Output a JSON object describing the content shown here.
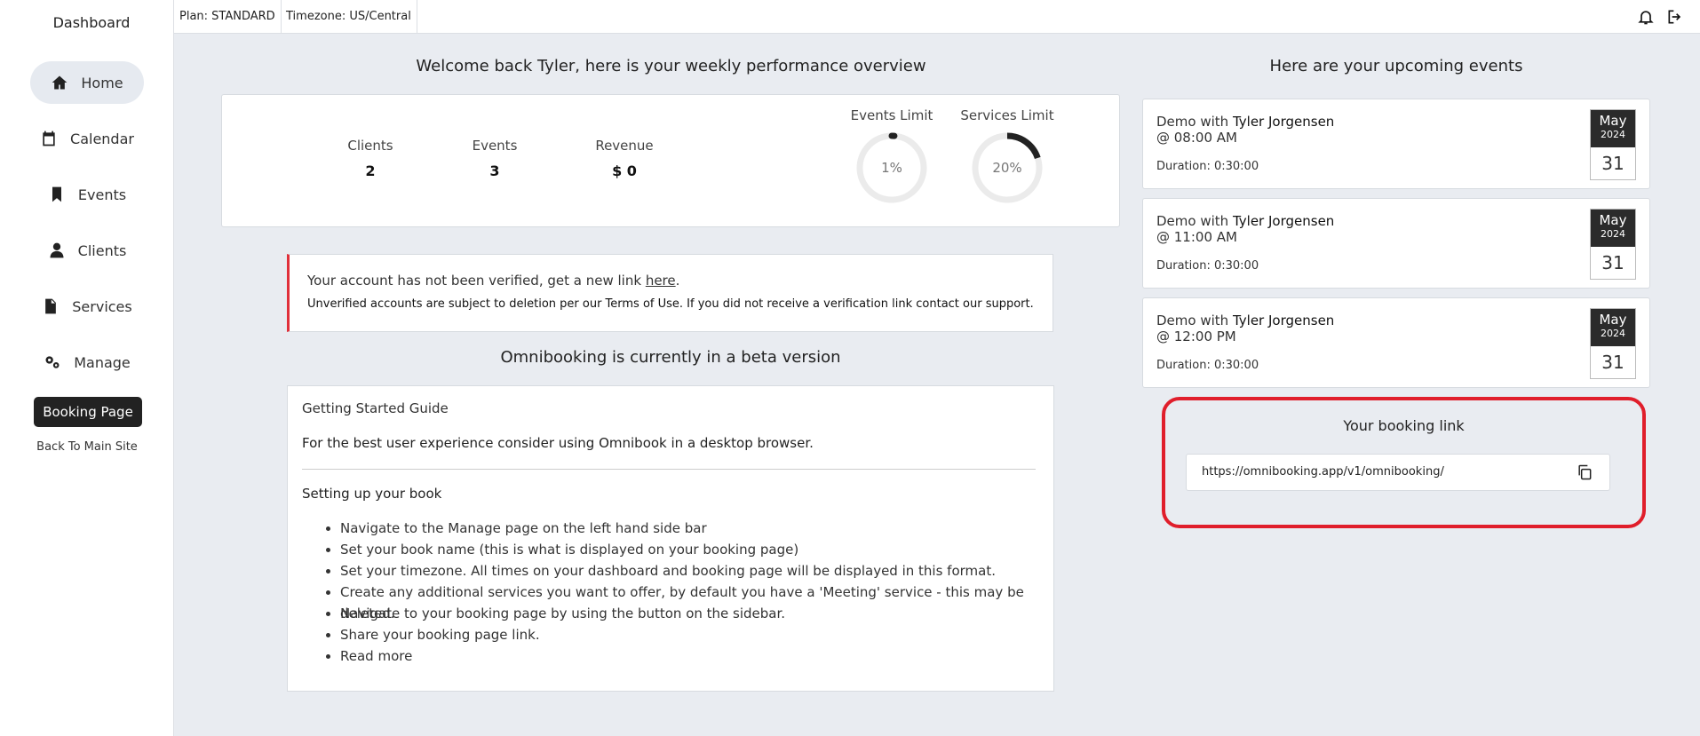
{
  "sidebar": {
    "title": "Dashboard",
    "items": [
      {
        "label": "Home",
        "icon": "home-icon",
        "active": true
      },
      {
        "label": "Calendar",
        "icon": "calendar-icon"
      },
      {
        "label": "Events",
        "icon": "bookmark-icon"
      },
      {
        "label": "Clients",
        "icon": "user-icon"
      },
      {
        "label": "Services",
        "icon": "document-icon"
      },
      {
        "label": "Manage",
        "icon": "gears-icon"
      }
    ],
    "booking_button": "Booking Page",
    "back_link": "Back To Main Site"
  },
  "topbar": {
    "plan": "Plan: STANDARD",
    "timezone": "Timezone: US/Central",
    "icons": [
      "bell-icon",
      "logout-icon"
    ]
  },
  "overview": {
    "heading": "Welcome back Tyler, here is your weekly performance overview",
    "stats": [
      {
        "label": "Clients",
        "value": "2"
      },
      {
        "label": "Events",
        "value": "3"
      },
      {
        "label": "Revenue",
        "value": "$ 0"
      }
    ],
    "limits": [
      {
        "label": "Events Limit",
        "value": "1%",
        "percent": 1
      },
      {
        "label": "Services Limit",
        "value": "20%",
        "percent": 20
      }
    ]
  },
  "alert": {
    "text": "Your account has not been verified, get a new link",
    "link": "here",
    "period": ".",
    "note": "Unverified accounts are subject to deletion per our Terms of Use. If you did not receive a verification link contact our support."
  },
  "beta": {
    "heading": "Omnibooking is currently in a beta version"
  },
  "guide": {
    "title": "Getting Started Guide",
    "note": "For the best user experience consider using Omnibook in a desktop browser.",
    "subheading": "Setting up your book",
    "steps": [
      "Navigate to the Manage page on the left hand side bar",
      "Set your book name (this is what is displayed on your booking page)",
      "Set your timezone. All times on your dashboard and booking page will be displayed in this format.",
      "Create any additional services you want to offer, by default you have a 'Meeting' service - this may be deleted.",
      "Navigate to your booking page by using the button on the sidebar.",
      "Share your booking page link.",
      "Read more"
    ]
  },
  "events": {
    "heading": "Here are your upcoming events",
    "items": [
      {
        "prefix": "Demo with",
        "name": "Tyler Jorgensen",
        "time": "@ 08:00 AM",
        "duration": "Duration: 0:30:00",
        "month": "May",
        "year": "2024",
        "day": "31"
      },
      {
        "prefix": "Demo with",
        "name": "Tyler Jorgensen",
        "time": "@ 11:00 AM",
        "duration": "Duration: 0:30:00",
        "month": "May",
        "year": "2024",
        "day": "31"
      },
      {
        "prefix": "Demo with",
        "name": "Tyler Jorgensen",
        "time": "@ 12:00 PM",
        "duration": "Duration: 0:30:00",
        "month": "May",
        "year": "2024",
        "day": "31"
      }
    ]
  },
  "booking_link": {
    "label": "Your booking link",
    "url": "https://omnibooking.app/v1/omnibooking/",
    "highlight_color": "#e01e2b"
  }
}
